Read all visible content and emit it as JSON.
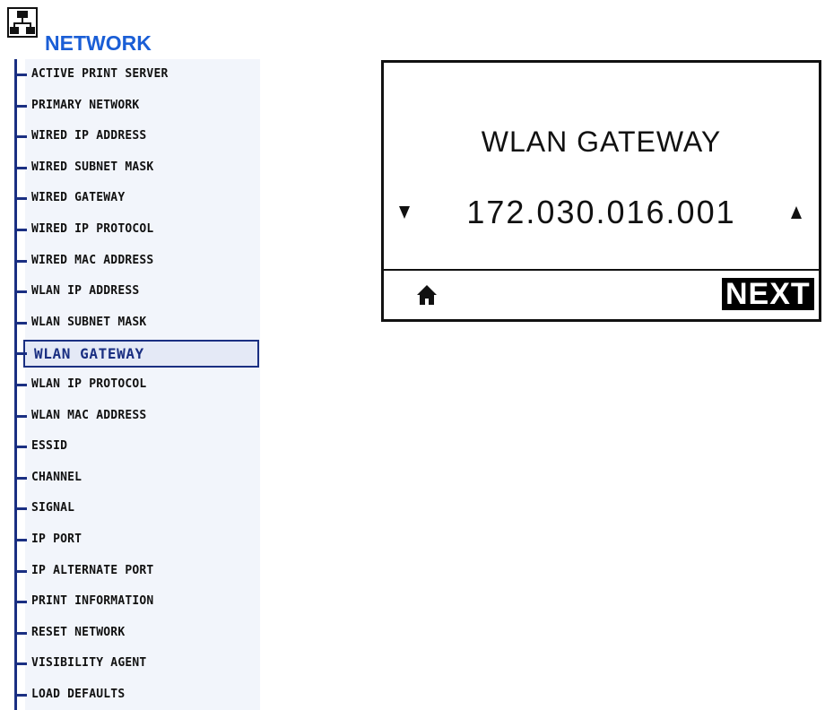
{
  "header": {
    "icon": "network-icon",
    "title": "NETWORK",
    "title_color": "#1a5ed6"
  },
  "menu": {
    "selected_index": 9,
    "items": [
      {
        "label": "ACTIVE PRINT SERVER"
      },
      {
        "label": "PRIMARY NETWORK"
      },
      {
        "label": "WIRED IP ADDRESS"
      },
      {
        "label": "WIRED SUBNET MASK"
      },
      {
        "label": "WIRED GATEWAY"
      },
      {
        "label": "WIRED IP PROTOCOL"
      },
      {
        "label": "WIRED MAC ADDRESS"
      },
      {
        "label": "WLAN IP ADDRESS"
      },
      {
        "label": "WLAN SUBNET MASK"
      },
      {
        "label": "WLAN GATEWAY"
      },
      {
        "label": "WLAN IP PROTOCOL"
      },
      {
        "label": "WLAN MAC ADDRESS"
      },
      {
        "label": "ESSID"
      },
      {
        "label": "CHANNEL"
      },
      {
        "label": "SIGNAL"
      },
      {
        "label": "IP PORT"
      },
      {
        "label": "IP ALTERNATE PORT"
      },
      {
        "label": "PRINT INFORMATION"
      },
      {
        "label": "RESET NETWORK"
      },
      {
        "label": "VISIBILITY AGENT"
      },
      {
        "label": "LOAD DEFAULTS"
      }
    ]
  },
  "display": {
    "title": "WLAN GATEWAY",
    "value": "172.030.016.001",
    "down_icon": "triangle-down-icon",
    "up_icon": "triangle-up-icon",
    "home_icon": "home-icon",
    "next_label": "NEXT"
  }
}
